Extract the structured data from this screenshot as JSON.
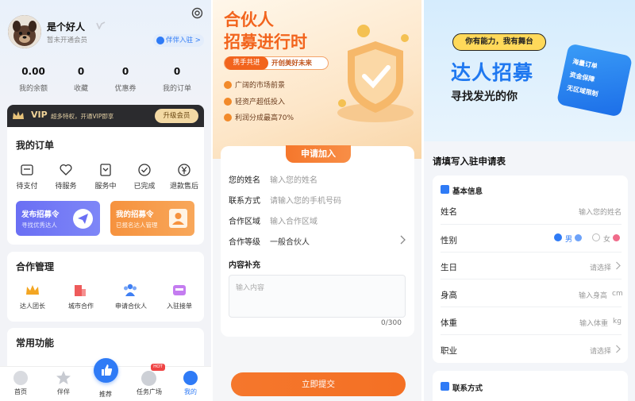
{
  "profile": {
    "name": "是个好人",
    "member_status": "暂未开通会员",
    "partner_badge": "伴伴入驻 >",
    "stats": [
      {
        "value": "0.00",
        "label": "我的余额"
      },
      {
        "value": "0",
        "label": "收藏"
      },
      {
        "value": "0",
        "label": "优惠券"
      },
      {
        "value": "0",
        "label": "我的订单"
      }
    ]
  },
  "vip": {
    "title": "VIP",
    "desc": "超多特权，开通VIP即享",
    "button": "升级会员"
  },
  "orders": {
    "title": "我的订单",
    "items": [
      {
        "label": "待支付",
        "icon": "wallet-icon"
      },
      {
        "label": "待服务",
        "icon": "heart-icon"
      },
      {
        "label": "服务中",
        "icon": "bookmark-icon"
      },
      {
        "label": "已完成",
        "icon": "check-circle-icon"
      },
      {
        "label": "退款售后",
        "icon": "yen-icon"
      }
    ]
  },
  "promos": [
    {
      "title": "发布招募令",
      "sub": "寻找优秀达人"
    },
    {
      "title": "我的招募令",
      "sub": "已报名达人管理"
    }
  ],
  "cooperation": {
    "title": "合作管理",
    "items": [
      {
        "label": "达人团长",
        "icon": "crown-icon"
      },
      {
        "label": "城市合作",
        "icon": "building-icon"
      },
      {
        "label": "申请合伙人",
        "icon": "people-icon"
      },
      {
        "label": "入驻接单",
        "icon": "store-icon"
      }
    ]
  },
  "common": {
    "title": "常用功能"
  },
  "tabbar": {
    "items": [
      {
        "label": "首页"
      },
      {
        "label": "伴伴"
      },
      {
        "label": "推荐"
      },
      {
        "label": "任务广场",
        "badge": "HOT"
      },
      {
        "label": "我的"
      }
    ]
  },
  "partner": {
    "title_line1": "合伙人",
    "title_line2": "招募进行时",
    "ribbon_left": "携手共进",
    "ribbon_right": "开创美好未来",
    "points": [
      "广阔的市场前景",
      "轻资产超低投入",
      "利润分成最高70%"
    ],
    "form_tab": "申请加入",
    "fields": [
      {
        "label": "您的姓名",
        "placeholder": "输入您的姓名"
      },
      {
        "label": "联系方式",
        "placeholder": "请输入您的手机号码"
      },
      {
        "label": "合作区域",
        "placeholder": "输入合作区域"
      },
      {
        "label": "合作等级",
        "value": "一般合伙人"
      }
    ],
    "content_label": "内容补充",
    "content_placeholder": "输入内容",
    "counter": "0/300",
    "submit": "立即提交"
  },
  "talent": {
    "bubble": "你有能力，我有舞台",
    "title": "达人招募",
    "subtitle": "寻找发光的你",
    "tag_lines": [
      "海量订单",
      "资金保障",
      "无区域限制"
    ],
    "form_title": "请填写入驻申请表",
    "basic_title": "基本信息",
    "rows": [
      {
        "label": "姓名",
        "value": "输入您的姓名"
      },
      {
        "label": "性别",
        "male": "男",
        "female": "女"
      },
      {
        "label": "生日",
        "value": "请选择"
      },
      {
        "label": "身高",
        "value": "输入身高",
        "unit": "cm"
      },
      {
        "label": "体重",
        "value": "输入体重",
        "unit": "kg"
      },
      {
        "label": "职业",
        "value": "请选择"
      }
    ],
    "contact_title": "联系方式"
  },
  "colors": {
    "accent_blue": "#2f7bf6",
    "accent_orange": "#f5772c",
    "gold": "#d9a24a",
    "vip_bg": "#2b2b2e"
  }
}
